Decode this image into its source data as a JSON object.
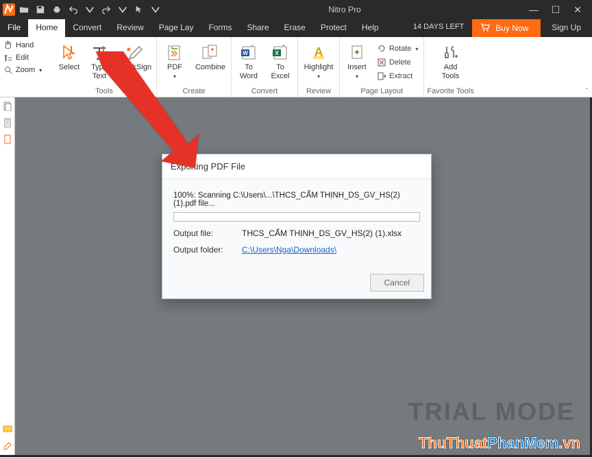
{
  "app": {
    "title": "Nitro Pro"
  },
  "trial": {
    "days_left": "14 DAYS LEFT",
    "buy": "Buy Now",
    "signup": "Sign Up"
  },
  "tabs": {
    "file": "File",
    "home": "Home",
    "convert": "Convert",
    "review": "Review",
    "pagelayout": "Page Lay",
    "forms": "Forms",
    "share": "Share",
    "erase": "Erase",
    "protect": "Protect",
    "help": "Help"
  },
  "left_tools": {
    "hand": "Hand",
    "edit": "Edit",
    "zoom": "Zoom"
  },
  "ribbon": {
    "tools": {
      "label": "Tools",
      "select": "Select",
      "typetext": "Type\nText",
      "quicksign": "QuickSign"
    },
    "create": {
      "label": "Create",
      "pdf": "PDF",
      "combine": "Combine"
    },
    "convert": {
      "label": "Convert",
      "toword": "To\nWord",
      "toexcel": "To\nExcel"
    },
    "review": {
      "label": "Review",
      "highlight": "Highlight"
    },
    "pagelayout": {
      "label": "Page Layout",
      "insert": "Insert",
      "rotate": "Rotate",
      "delete": "Delete",
      "extract": "Extract"
    },
    "fav": {
      "label": "Favorite Tools",
      "addtools": "Add\nTools"
    }
  },
  "dialog": {
    "title": "Exporting PDF File",
    "progress": "100%: Scanning C:\\Users\\...\\THCS_CẨM THỊNH_DS_GV_HS(2) (1).pdf file...",
    "output_file_label": "Output file:",
    "output_file_value": "THCS_CẨM THỊNH_DS_GV_HS(2) (1).xlsx",
    "output_folder_label": "Output folder:",
    "output_folder_value": "C:\\Users\\Nga\\Downloads\\",
    "cancel": "Cancel"
  },
  "trial_mode": "TRIAL MODE",
  "watermark": {
    "a": "ThuThuat",
    "b": "PhanMem",
    "c": ".vn"
  }
}
